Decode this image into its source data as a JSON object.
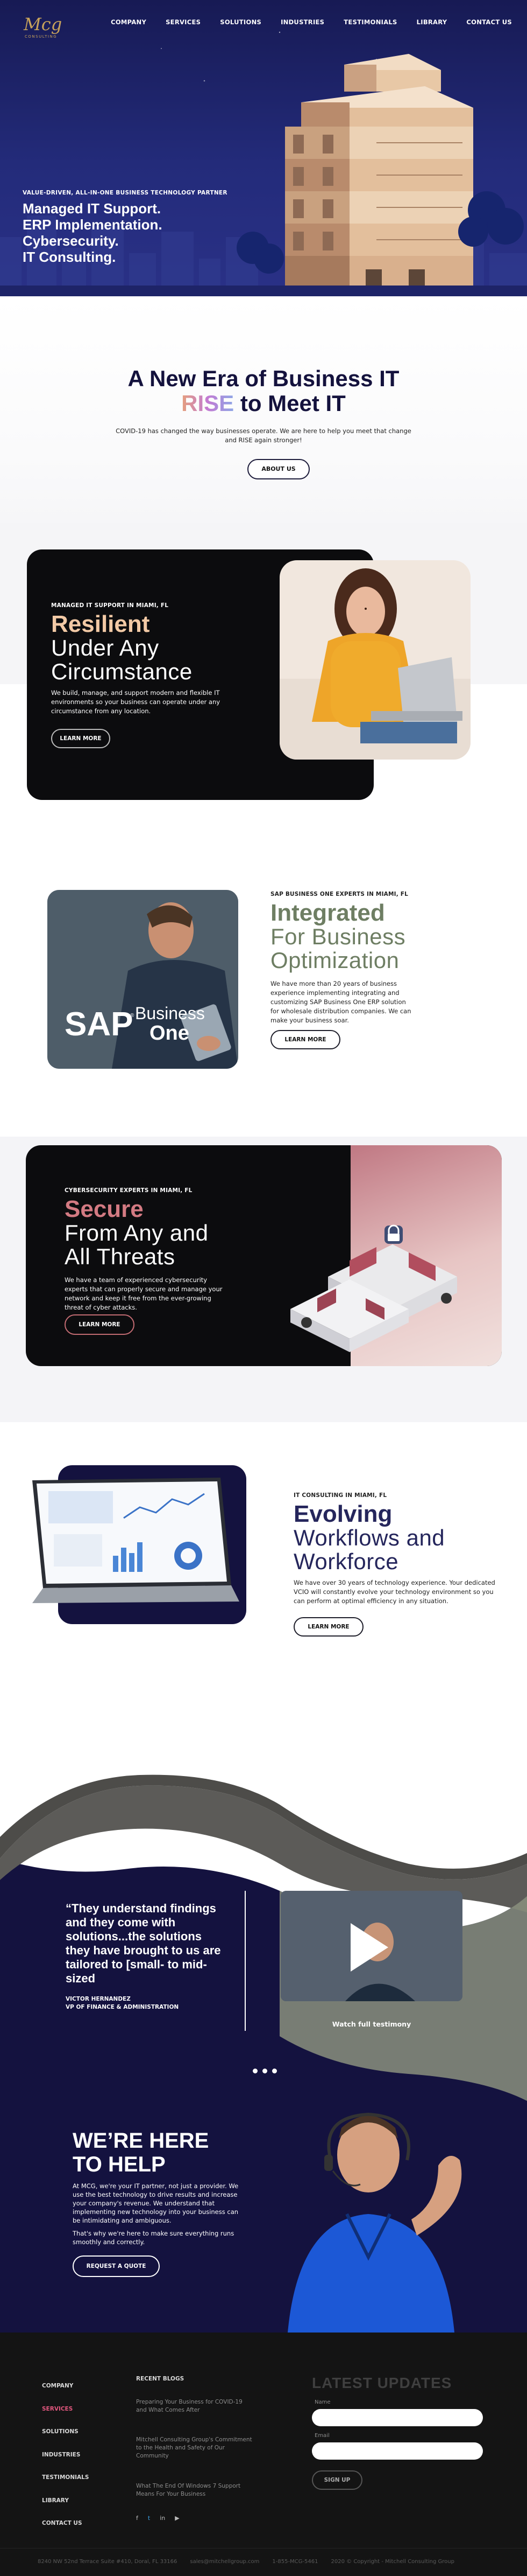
{
  "brand": {
    "logo_text": "MCG",
    "logo_sub": "CONSULTING"
  },
  "nav": {
    "items": [
      "COMPANY",
      "SERVICES",
      "SOLUTIONS",
      "INDUSTRIES",
      "TESTIMONIALS",
      "LIBRARY",
      "CONTACT US"
    ]
  },
  "hero": {
    "eyebrow": "VALUE-DRIVEN, ALL-IN-ONE BUSINESS TECHNOLOGY PARTNER",
    "lines": [
      "Managed IT Support.",
      "ERP Implementation.",
      "Cybersecurity.",
      "IT Consulting."
    ]
  },
  "intro": {
    "title_line1": "A New Era of Business IT",
    "title_rise": "RISE",
    "title_line2_rest": " to Meet IT",
    "text": "COVID-19 has changed the way businesses operate. We are here to help you meet that change and RISE again stronger!",
    "button": "ABOUT US"
  },
  "s1": {
    "eyebrow": "MANAGED IT SUPPORT IN MIAMI, FL",
    "title": "Resilient",
    "sub1": "Under Any",
    "sub2": "Circumstance",
    "text": "We build, manage, and support modern and flexible IT environments so your business can operate under any circumstance from any location.",
    "button": "LEARN MORE"
  },
  "s2": {
    "eyebrow": "SAP BUSINESS ONE EXPERTS IN MIAMI, FL",
    "title": "Integrated",
    "sub1": "For Business",
    "sub2": "Optimization",
    "text": "We have more than 20 years of business experience implementing integrating and customizing SAP Business One ERP solution for wholesale distribution companies. We can make your business soar.",
    "button": "LEARN MORE",
    "sap_logo": "SAP",
    "sap_text1": "Business",
    "sap_text2": "One"
  },
  "s3": {
    "eyebrow": "CYBERSECURITY EXPERTS IN MIAMI, FL",
    "title": "Secure",
    "sub1": "From Any and",
    "sub2": "All Threats",
    "text": "We have a team of experienced cybersecurity experts that can properly secure and manage your network and keep it free from the ever-growing threat of cyber attacks.",
    "button": "LEARN MORE"
  },
  "s4": {
    "eyebrow": "IT CONSULTING IN MIAMI, FL",
    "title": "Evolving",
    "sub1": "Workflows and",
    "sub2": "Workforce",
    "text": "We have over 30 years of technology experience. Your dedicated VCIO will constantly evolve your technology environment so you can perform at optimal efficiency in any situation.",
    "button": "LEARN MORE"
  },
  "testimonial": {
    "quote": "“They understand findings and they come with solutions...the solutions they have brought to us are tailored to [small- to mid-sized",
    "name": "VICTOR HERNANDEZ",
    "role": "VP OF FINANCE & ADMINISTRATION",
    "video_caption": "Watch full testimony"
  },
  "help": {
    "title_line1": "WE’RE HERE",
    "title_line2": "TO HELP",
    "text1": "At MCG, we're your IT partner, not just a provider. We use the best technology to drive results and increase your company's revenue. We understand that implementing new technology into your business can be intimidating and ambiguous.",
    "text2": "That's why we're here to make sure everything runs smoothly and correctly.",
    "button": "REQUEST A QUOTE"
  },
  "footer": {
    "links": [
      "COMPANY",
      "SERVICES",
      "SOLUTIONS",
      "INDUSTRIES",
      "TESTIMONIALS",
      "LIBRARY",
      "CONTACT US"
    ],
    "recent_title": "RECENT BLOGS",
    "blogs": [
      "Preparing Your Business for COVID-19 and What Comes After",
      "Mitchell Consulting Group's Commitment to the Health and Safety of Our Community",
      "What The End Of Windows 7 Support Means For Your Business"
    ],
    "updates_title": "LATEST UPDATES",
    "name_label": "Name",
    "email_label": "Email",
    "signup": "SIGN UP",
    "bottom": [
      "8240 NW 52nd Terrace Suite #410, Doral, FL 33166",
      "sales@mitchellgroup.com",
      "1-855-MCG-5461",
      "2020 © Copyright - Mitchell Consulting Group"
    ]
  },
  "colors": {
    "navy": "#171a54",
    "rise_gradient": [
      "#e6a07c",
      "#c37ad3",
      "#8da6e6"
    ],
    "resilient": "#f2c9a5",
    "integrated": "#6e7e63",
    "secure": "#d37a82",
    "evolving": "#25265c"
  }
}
